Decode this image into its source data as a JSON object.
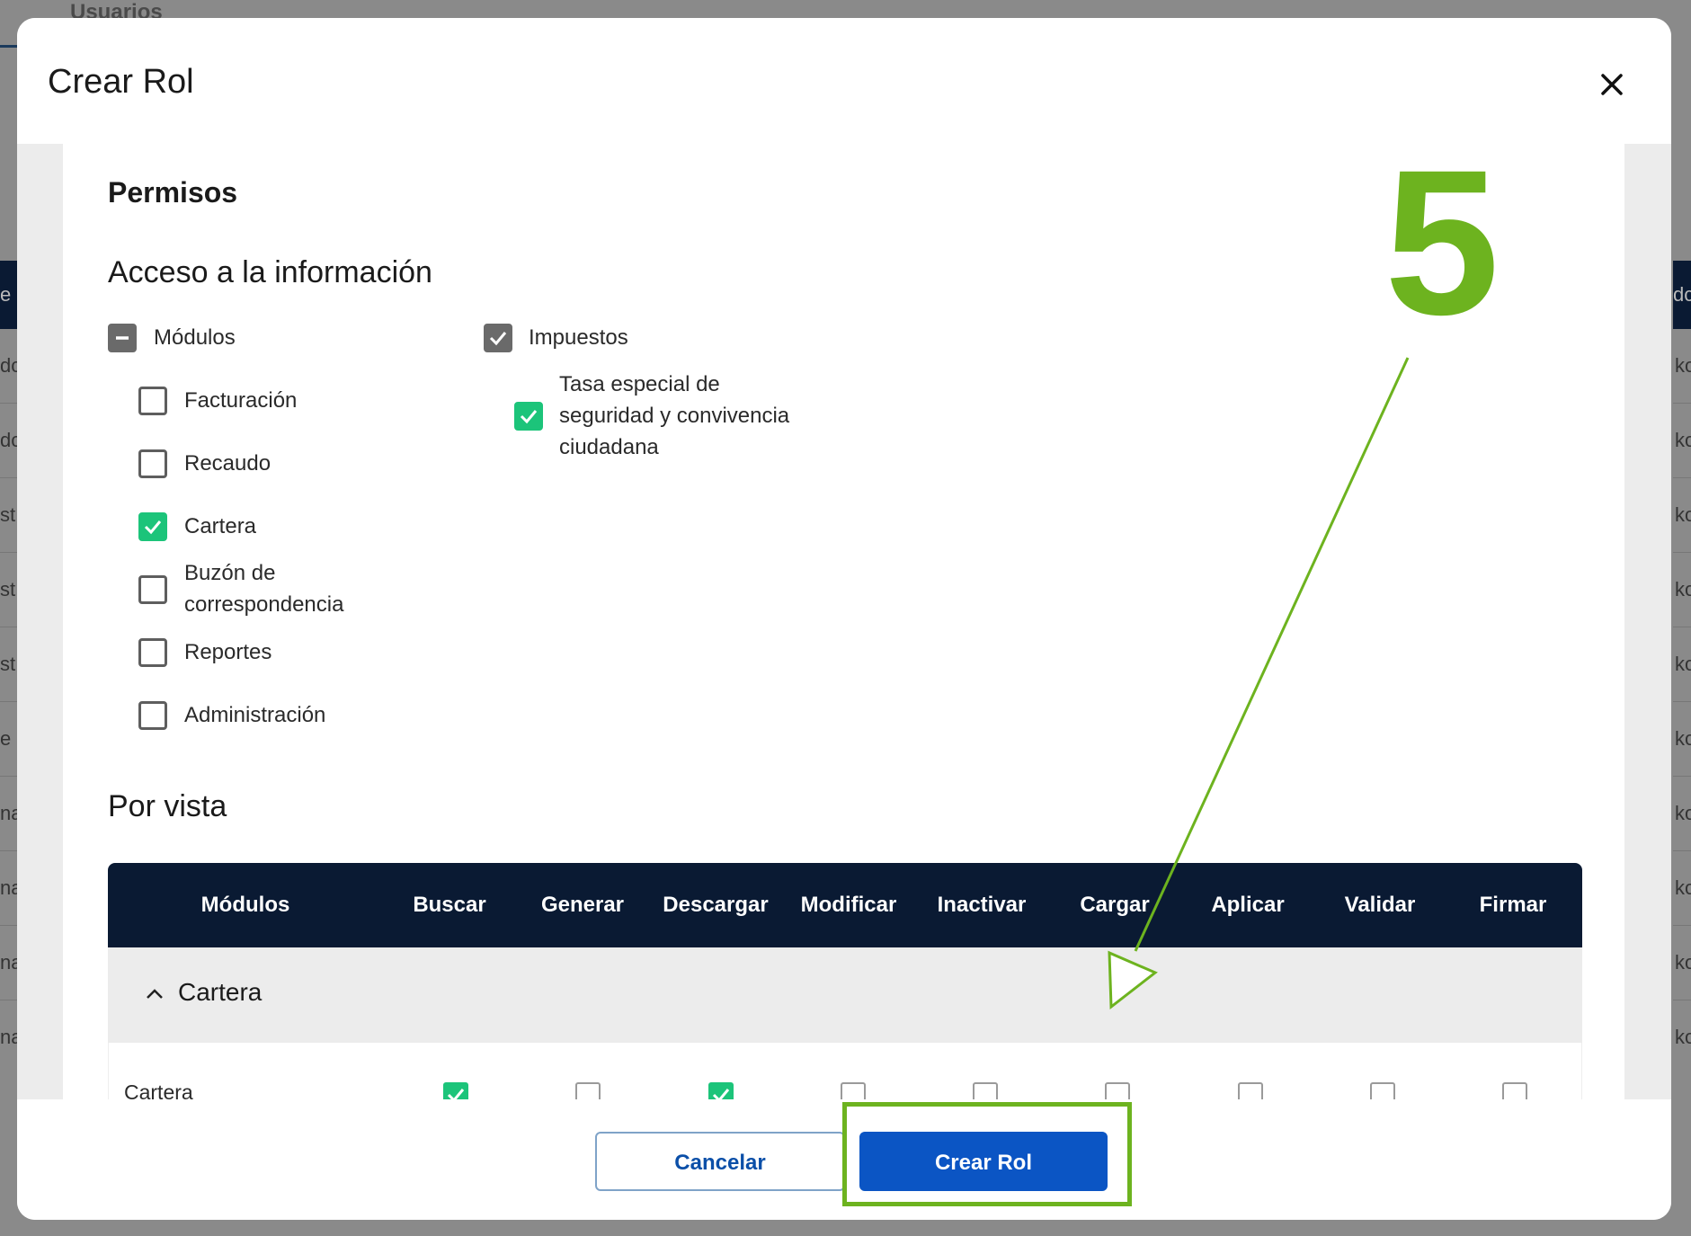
{
  "background": {
    "top_tab": "Usuarios",
    "left_col": {
      "head": "e",
      "cells": [
        "dc",
        "dc",
        "st",
        "st",
        "st",
        "e",
        "na",
        "na",
        "na",
        "na"
      ]
    },
    "right_col": {
      "head": "dc",
      "cells": [
        "ko",
        "ko",
        "ko",
        "ko",
        "ko",
        "ko",
        "ko",
        "ko",
        "ko",
        "ko"
      ]
    }
  },
  "modal": {
    "title": "Crear Rol",
    "section_title": "Permisos",
    "access": {
      "title": "Acceso a la información",
      "modules": {
        "label": "Módulos",
        "state": "indeterminate",
        "items": [
          {
            "label": "Facturación",
            "checked": false
          },
          {
            "label": "Recaudo",
            "checked": false
          },
          {
            "label": "Cartera",
            "checked": true
          },
          {
            "label": "Buzón de correspondencia",
            "line1": "Buzón de",
            "line2": "correspondencia",
            "checked": false
          },
          {
            "label": "Reportes",
            "checked": false
          },
          {
            "label": "Administración",
            "checked": false
          }
        ]
      },
      "taxes": {
        "label": "Impuestos",
        "checked": true,
        "items": [
          {
            "label": "Tasa especial de seguridad y convivencia ciudadana",
            "line1": "Tasa especial de",
            "line2": "seguridad y convivencia",
            "line3": "ciudadana",
            "checked": true
          }
        ]
      }
    },
    "by_view": {
      "title": "Por vista",
      "columns": [
        "Módulos",
        "Buscar",
        "Generar",
        "Descargar",
        "Modificar",
        "Inactivar",
        "Cargar",
        "Aplicar",
        "Validar",
        "Firmar"
      ],
      "group": {
        "label": "Cartera",
        "expanded": true
      },
      "rows": [
        {
          "label": "Cartera",
          "checks": [
            true,
            false,
            true,
            false,
            false,
            false,
            false,
            false,
            false
          ]
        }
      ]
    },
    "footer": {
      "cancel_label": "Cancelar",
      "create_label": "Crear Rol"
    }
  },
  "annotation": {
    "step_number": "5",
    "color": "#6db31f"
  },
  "colors": {
    "table_header": "#0a1a33",
    "primary_button": "#0b55c4",
    "check_green": "#1cc47a"
  }
}
